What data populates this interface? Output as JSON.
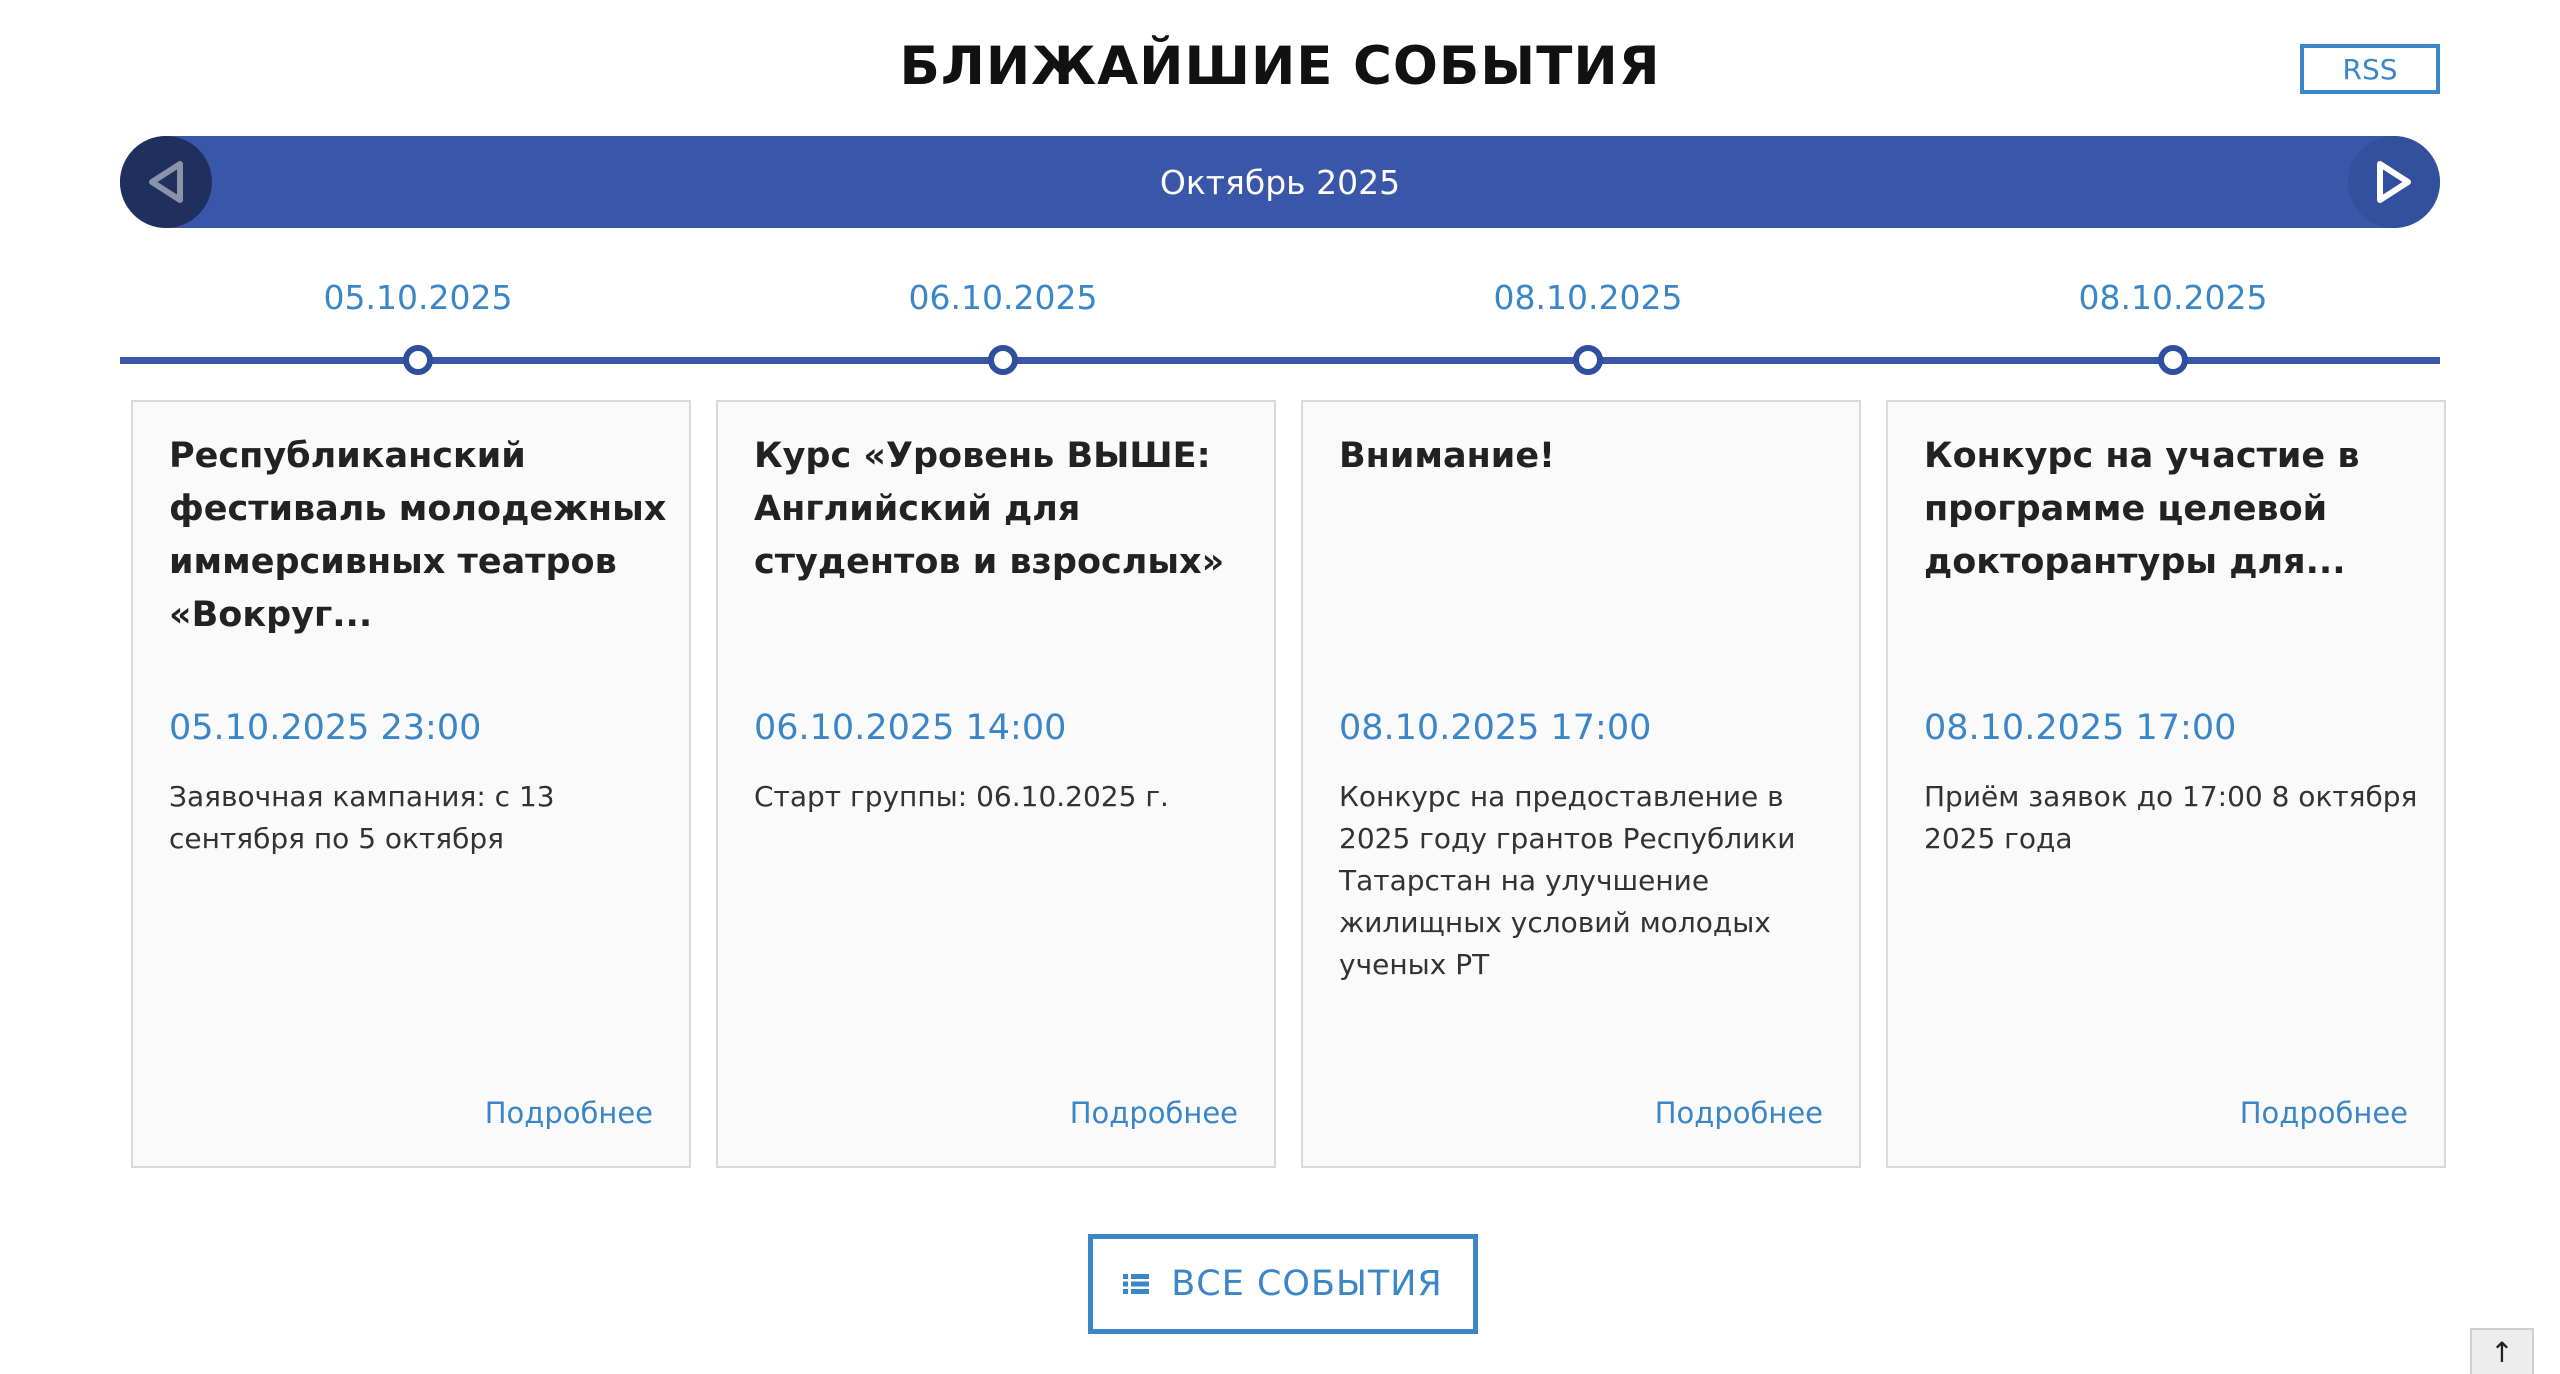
{
  "header": {
    "title": "БЛИЖАЙШИЕ СОБЫТИЯ",
    "rss_label": "RSS"
  },
  "month_nav": {
    "label": "Октябрь 2025",
    "prev_icon": "triangle-left-icon",
    "next_icon": "triangle-right-icon"
  },
  "timeline": {
    "dates": [
      "05.10.2025",
      "06.10.2025",
      "08.10.2025",
      "08.10.2025"
    ]
  },
  "events": [
    {
      "title": "Республиканский фестиваль молодежных иммерсивных театров «Вокруг...",
      "datetime": "05.10.2025 23:00",
      "description": "Заявочная кампания: с 13 сентября по 5 октября",
      "more": "Подробнее"
    },
    {
      "title": "Курс «Уровень ВЫШЕ: Английский для студентов и взрослых»",
      "datetime": "06.10.2025 14:00",
      "description": "Старт группы: 06.10.2025 г.",
      "more": "Подробнее"
    },
    {
      "title": "Внимание!",
      "datetime": "08.10.2025 17:00",
      "description": "Конкурс на предоставление в 2025 году грантов Республики Татарстан на улучшение жилищных условий молодых ученых РТ",
      "more": "Подробнее"
    },
    {
      "title": "Конкурс на участие в программе целевой докторантуры для...",
      "datetime": "08.10.2025 17:00",
      "description": "Приём заявок до 17:00 8 октября 2025 года",
      "more": "Подробнее"
    }
  ],
  "all_events": {
    "label": "ВСЕ СОБЫТИЯ",
    "icon": "list-icon"
  },
  "scroll_top": {
    "label": "↑"
  },
  "colors": {
    "primary": "#3a56a8",
    "accent": "#3a86c8",
    "nav_dark": "#1f2f5e"
  }
}
